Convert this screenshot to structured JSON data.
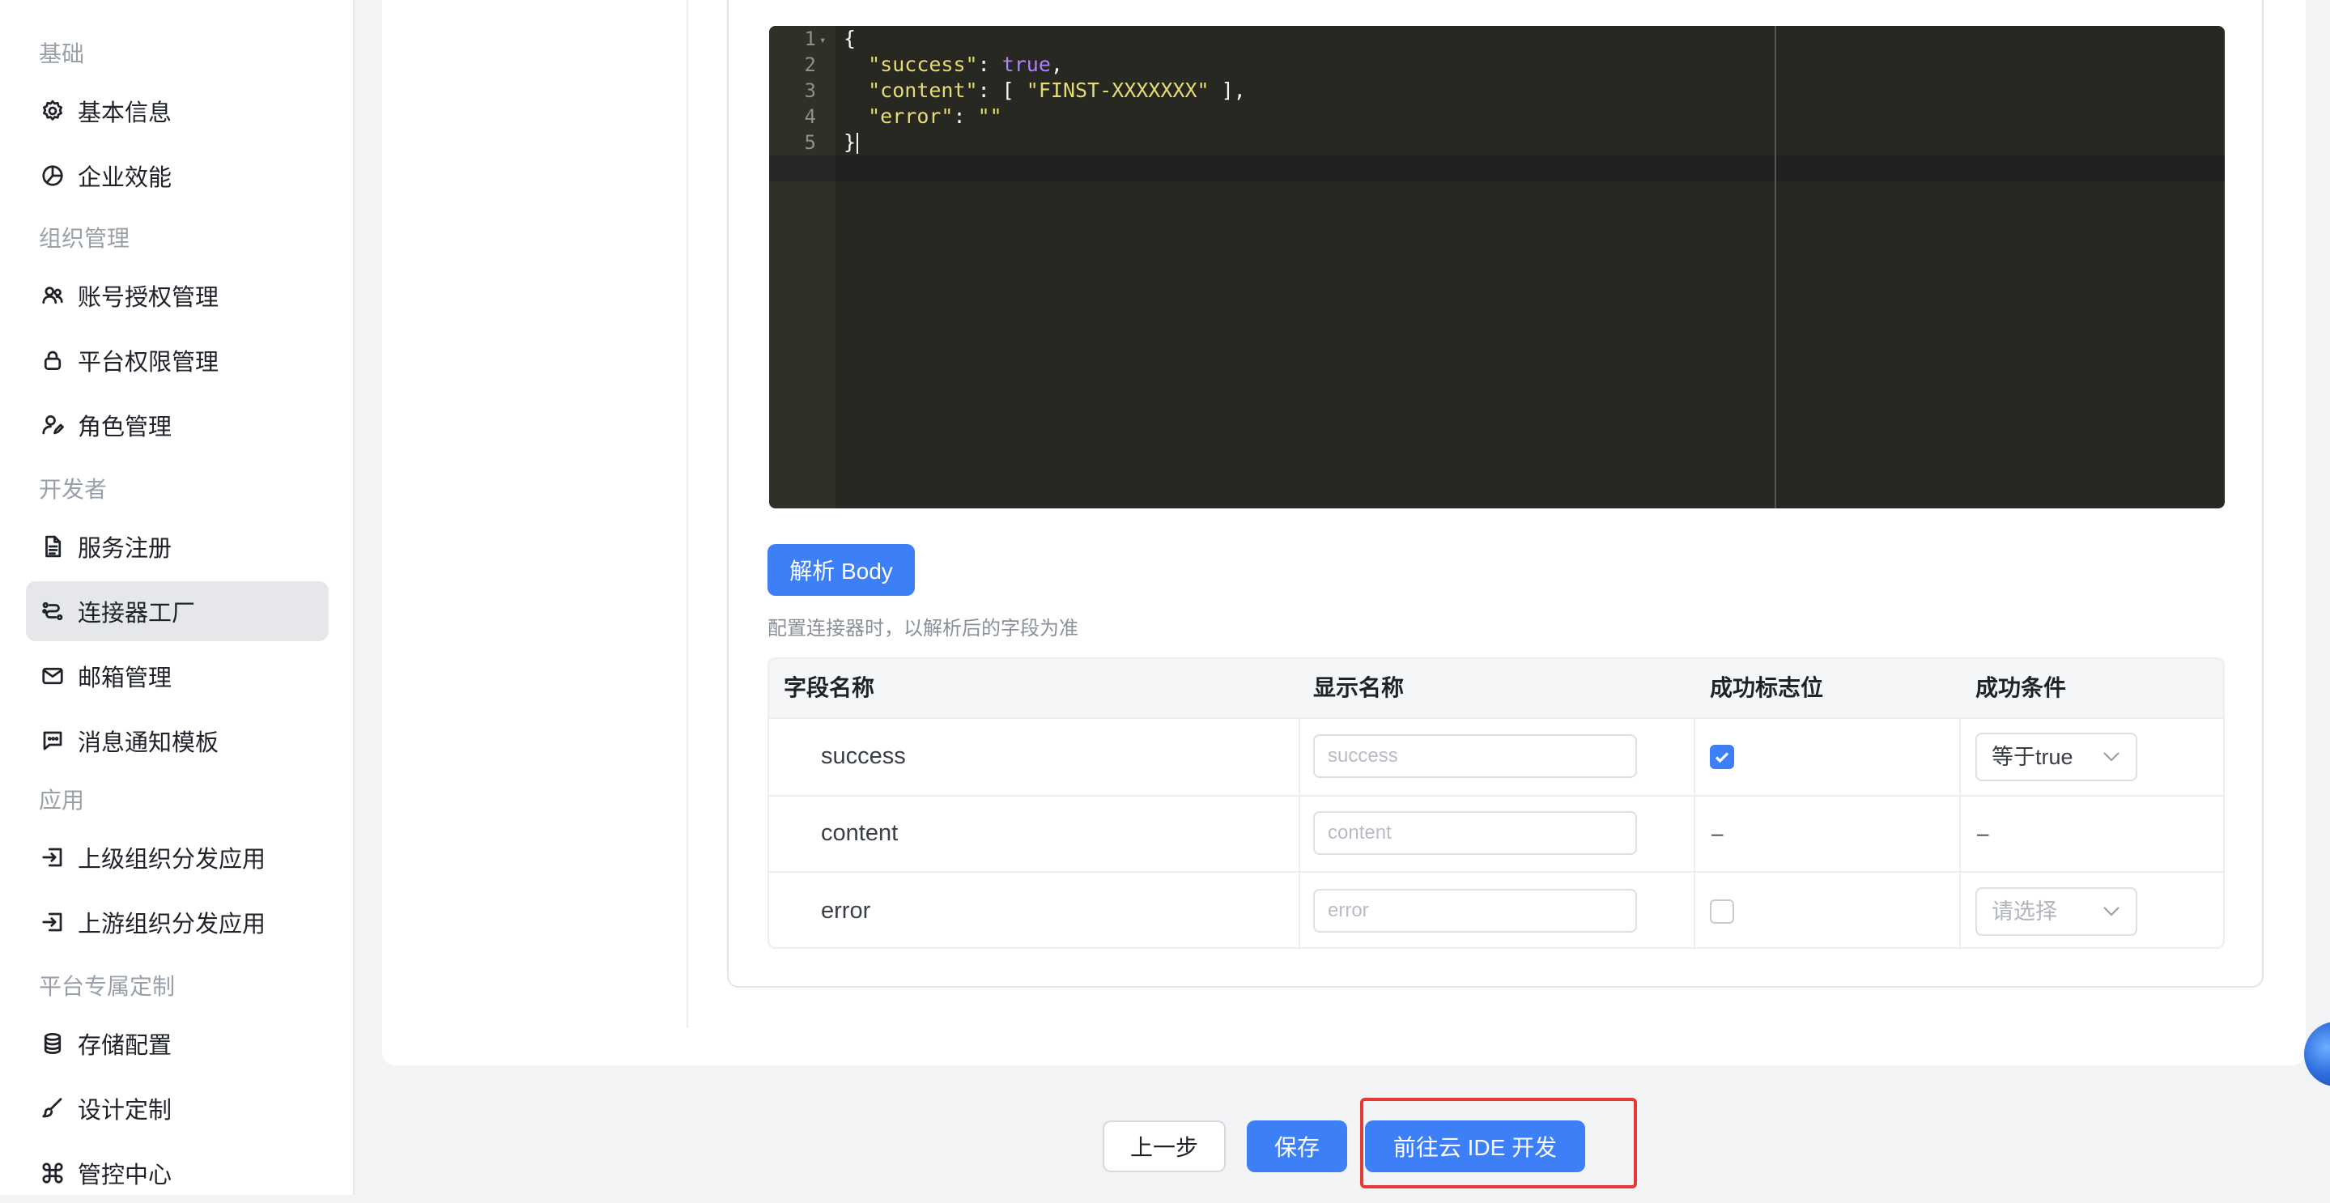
{
  "sidebar": {
    "groups": [
      {
        "title": "基础",
        "items": [
          {
            "label": "基本信息",
            "icon": "gear-icon"
          },
          {
            "label": "企业效能",
            "icon": "pie-chart-icon"
          }
        ]
      },
      {
        "title": "组织管理",
        "items": [
          {
            "label": "账号授权管理",
            "icon": "users-icon"
          },
          {
            "label": "平台权限管理",
            "icon": "lock-icon"
          },
          {
            "label": "角色管理",
            "icon": "user-edit-icon"
          }
        ]
      },
      {
        "title": "开发者",
        "items": [
          {
            "label": "服务注册",
            "icon": "document-icon"
          },
          {
            "label": "连接器工厂",
            "icon": "connector-icon",
            "active": true
          },
          {
            "label": "邮箱管理",
            "icon": "mail-icon"
          },
          {
            "label": "消息通知模板",
            "icon": "message-icon"
          }
        ]
      },
      {
        "title": "应用",
        "items": [
          {
            "label": "上级组织分发应用",
            "icon": "login-icon"
          },
          {
            "label": "上游组织分发应用",
            "icon": "login-icon"
          }
        ]
      },
      {
        "title": "平台专属定制",
        "items": [
          {
            "label": "存储配置",
            "icon": "database-icon"
          },
          {
            "label": "设计定制",
            "icon": "brush-icon"
          },
          {
            "label": "管控中心",
            "icon": "command-icon"
          }
        ]
      }
    ]
  },
  "editor": {
    "line_numbers": [
      "1",
      "2",
      "3",
      "4",
      "5"
    ],
    "lines": [
      {
        "parts": [
          {
            "t": "{",
            "c": "k"
          }
        ]
      },
      {
        "parts": [
          {
            "t": "  ",
            "c": "k"
          },
          {
            "t": "\"success\"",
            "c": "s"
          },
          {
            "t": ": ",
            "c": "k"
          },
          {
            "t": "true",
            "c": "b"
          },
          {
            "t": ",",
            "c": "k"
          }
        ]
      },
      {
        "parts": [
          {
            "t": "  ",
            "c": "k"
          },
          {
            "t": "\"content\"",
            "c": "s"
          },
          {
            "t": ": [ ",
            "c": "k"
          },
          {
            "t": "\"FINST-XXXXXXX\"",
            "c": "s"
          },
          {
            "t": " ],",
            "c": "k"
          }
        ]
      },
      {
        "parts": [
          {
            "t": "  ",
            "c": "k"
          },
          {
            "t": "\"error\"",
            "c": "s"
          },
          {
            "t": ": ",
            "c": "k"
          },
          {
            "t": "\"\"",
            "c": "s"
          }
        ]
      },
      {
        "parts": [
          {
            "t": "}",
            "c": "k"
          }
        ]
      }
    ]
  },
  "parse_button_label": "解析 Body",
  "hint": "配置连接器时，以解析后的字段为准",
  "table": {
    "headers": [
      "字段名称",
      "显示名称",
      "成功标志位",
      "成功条件"
    ],
    "rows": [
      {
        "name": "success",
        "placeholder": "success",
        "flag": "checked",
        "condition": "等于true"
      },
      {
        "name": "content",
        "placeholder": "content",
        "flag": "–",
        "condition": "–"
      },
      {
        "name": "error",
        "placeholder": "error",
        "flag": "unchecked",
        "condition": "请选择"
      }
    ]
  },
  "footer": {
    "prev_label": "上一步",
    "save_label": "保存",
    "ide_label": "前往云 IDE 开发"
  },
  "colors": {
    "accent": "#3d7ff7",
    "highlight": "#e53935",
    "editor_bg": "#272822"
  }
}
